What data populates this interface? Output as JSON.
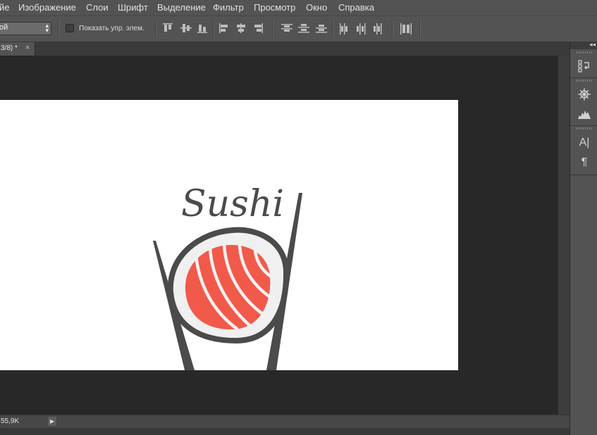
{
  "menu": {
    "items": [
      "йе",
      "Изображение",
      "Слои",
      "Шрифт",
      "Выделение",
      "Фильтр",
      "Просмотр",
      "Окно",
      "Справка"
    ]
  },
  "options_bar": {
    "select_value": "ой",
    "checkbox_label": "Показать упр. элем."
  },
  "document": {
    "tab_title": "3/8) *",
    "close_glyph": "×",
    "logo_text": "Sushi"
  },
  "status": {
    "doc_size": "55,9K",
    "menu_arrow": "▶"
  },
  "panel": {
    "collapse_glyph": "◂◂",
    "icons": [
      "history-icon",
      "navigator-icon",
      "histogram-icon",
      "character-icon",
      "paragraph-icon"
    ],
    "character_glyph": "A|",
    "paragraph_glyph": "¶"
  },
  "colors": {
    "salmon": "#f15a4a",
    "rice": "#f0f0f0",
    "ink": "#4b4b4b",
    "ui_bg": "#535353"
  }
}
